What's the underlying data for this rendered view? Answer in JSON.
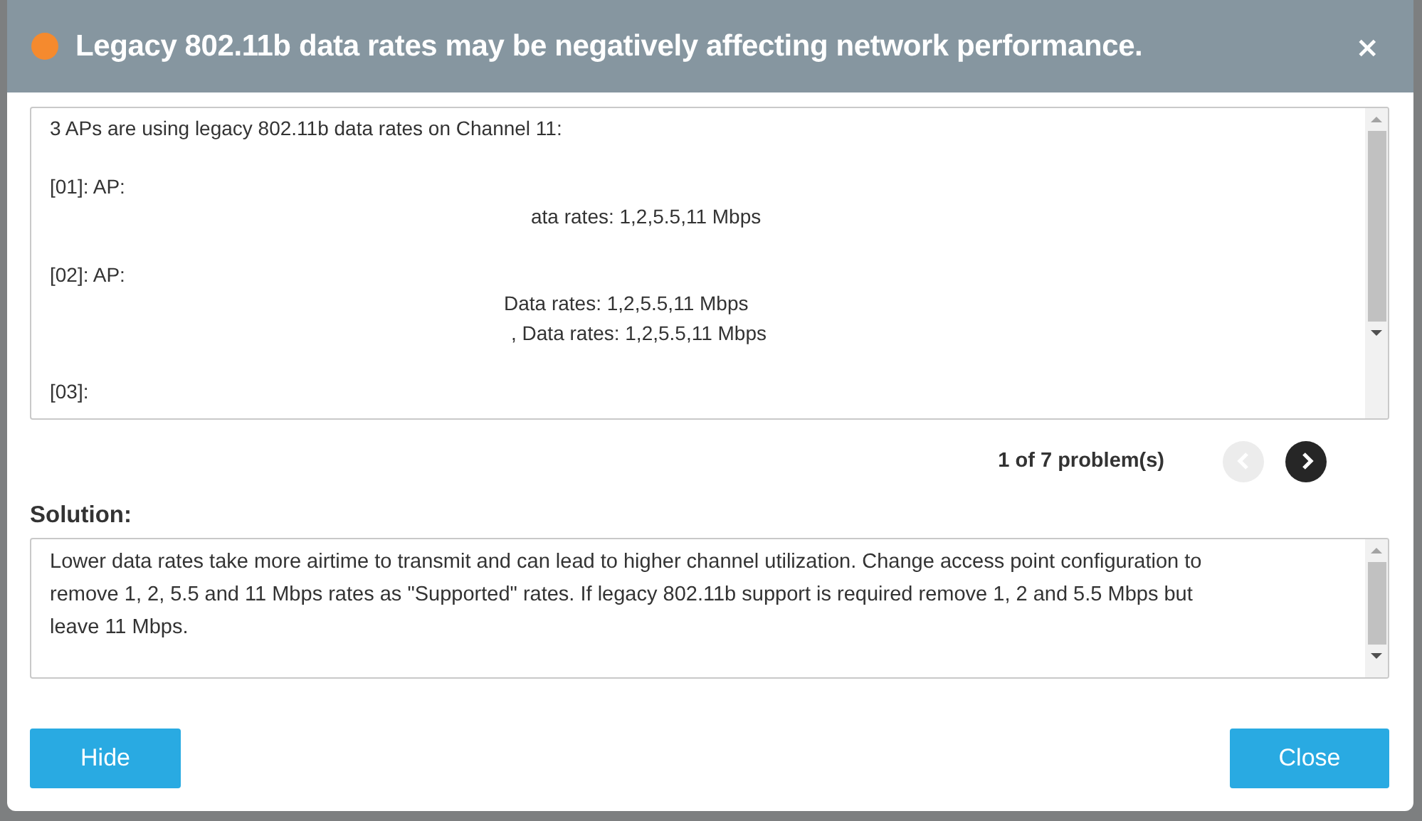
{
  "dialog": {
    "title": "Legacy 802.11b data rates may be negatively affecting network performance.",
    "close_icon": "×"
  },
  "problem": {
    "lines": [
      {
        "kind": "plain",
        "text": "3 APs are using legacy 802.11b data rates on Channel 11:"
      },
      {
        "kind": "gap"
      },
      {
        "kind": "plain",
        "text": "[01]: AP:"
      },
      {
        "kind": "detail",
        "text": "ata rates: 1,2,5.5,11 Mbps"
      },
      {
        "kind": "gap"
      },
      {
        "kind": "plain",
        "text": "[02]: AP:"
      },
      {
        "kind": "detail2",
        "text": "Data rates: 1,2,5.5,11 Mbps"
      },
      {
        "kind": "detail3",
        "text": ", Data rates: 1,2,5.5,11 Mbps"
      },
      {
        "kind": "gap"
      },
      {
        "kind": "plain",
        "text": "[03]:"
      }
    ]
  },
  "pager": {
    "text": "1 of 7 problem(s)",
    "previous": {
      "disabled": true
    },
    "next": {
      "disabled": false
    }
  },
  "solution": {
    "label": "Solution:",
    "text": "Lower data rates take more airtime to transmit and can lead to higher channel utilization.  Change access point configuration to remove 1, 2, 5.5 and 11 Mbps rates as \"Supported\" rates. If legacy 802.11b support is required remove 1, 2 and 5.5 Mbps but leave 11 Mbps."
  },
  "buttons": [
    {
      "kind": "left",
      "label": "Hide"
    },
    {
      "kind": "right",
      "label": "Close"
    }
  ]
}
